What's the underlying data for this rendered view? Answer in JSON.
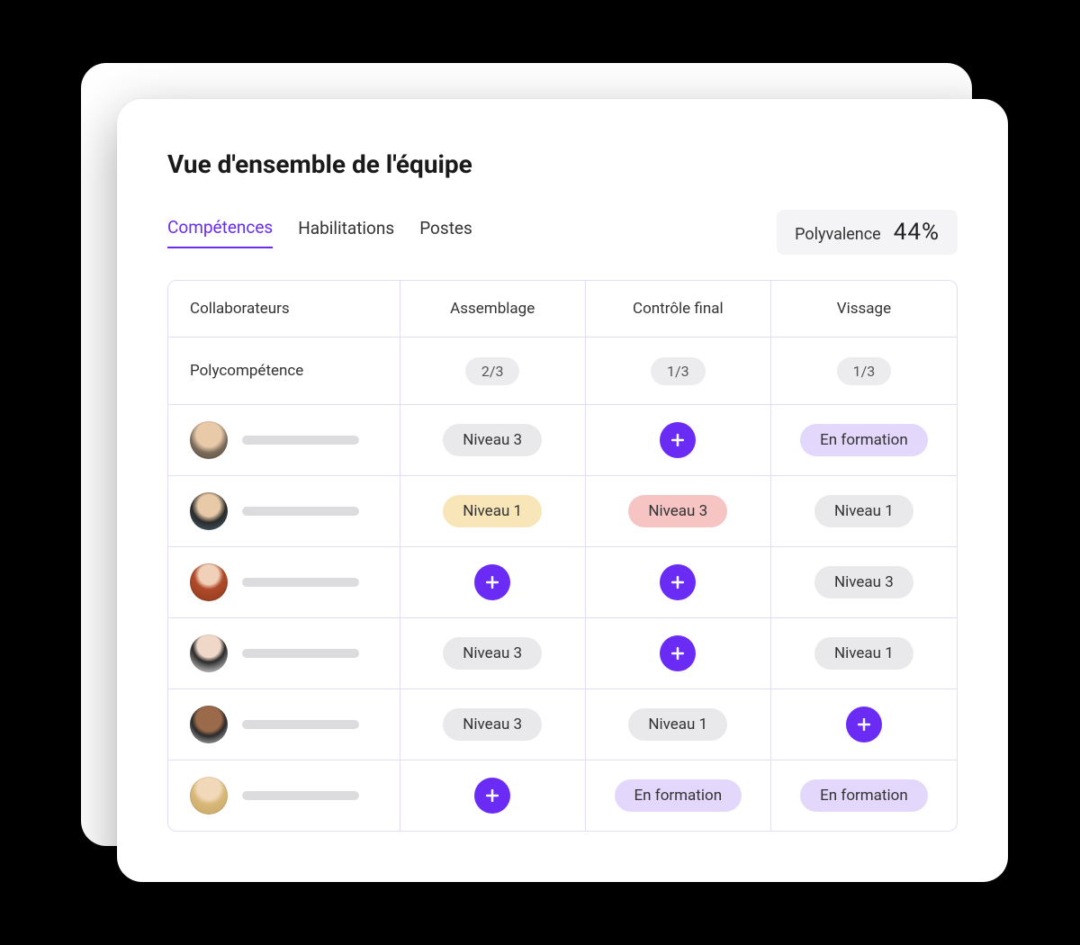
{
  "header": {
    "title": "Vue d'ensemble de l'équipe"
  },
  "tabs": [
    {
      "label": "Compétences",
      "active": true
    },
    {
      "label": "Habilitations",
      "active": false
    },
    {
      "label": "Postes",
      "active": false
    }
  ],
  "polyvalence": {
    "label": "Polyvalence",
    "value": "44%"
  },
  "columns": {
    "col0": "Collaborateurs",
    "col1": "Assemblage",
    "col2": "Contrôle final",
    "col3": "Vissage"
  },
  "polycompetence": {
    "label": "Polycompétence",
    "ratios": {
      "col1": "2/3",
      "col2": "1/3",
      "col3": "1/3"
    }
  },
  "labels": {
    "niveau1": "Niveau 1",
    "niveau3": "Niveau 3",
    "en_formation": "En formation"
  },
  "rows": [
    {
      "avatar": "av1",
      "cells": [
        {
          "type": "pill",
          "style": "gray",
          "text_key": "labels.niveau3"
        },
        {
          "type": "plus"
        },
        {
          "type": "pill",
          "style": "purple",
          "text_key": "labels.en_formation"
        }
      ]
    },
    {
      "avatar": "av2",
      "cells": [
        {
          "type": "pill",
          "style": "yellow",
          "text_key": "labels.niveau1"
        },
        {
          "type": "pill",
          "style": "red",
          "text_key": "labels.niveau3"
        },
        {
          "type": "pill",
          "style": "gray",
          "text_key": "labels.niveau1"
        }
      ]
    },
    {
      "avatar": "av3",
      "cells": [
        {
          "type": "plus"
        },
        {
          "type": "plus"
        },
        {
          "type": "pill",
          "style": "gray",
          "text_key": "labels.niveau3"
        }
      ]
    },
    {
      "avatar": "av4",
      "cells": [
        {
          "type": "pill",
          "style": "gray",
          "text_key": "labels.niveau3"
        },
        {
          "type": "plus"
        },
        {
          "type": "pill",
          "style": "gray",
          "text_key": "labels.niveau1"
        }
      ]
    },
    {
      "avatar": "av5",
      "cells": [
        {
          "type": "pill",
          "style": "gray",
          "text_key": "labels.niveau3"
        },
        {
          "type": "pill",
          "style": "gray",
          "text_key": "labels.niveau1"
        },
        {
          "type": "plus"
        }
      ]
    },
    {
      "avatar": "av6",
      "cells": [
        {
          "type": "plus"
        },
        {
          "type": "pill",
          "style": "purple",
          "text_key": "labels.en_formation"
        },
        {
          "type": "pill",
          "style": "purple",
          "text_key": "labels.en_formation"
        }
      ]
    }
  ]
}
